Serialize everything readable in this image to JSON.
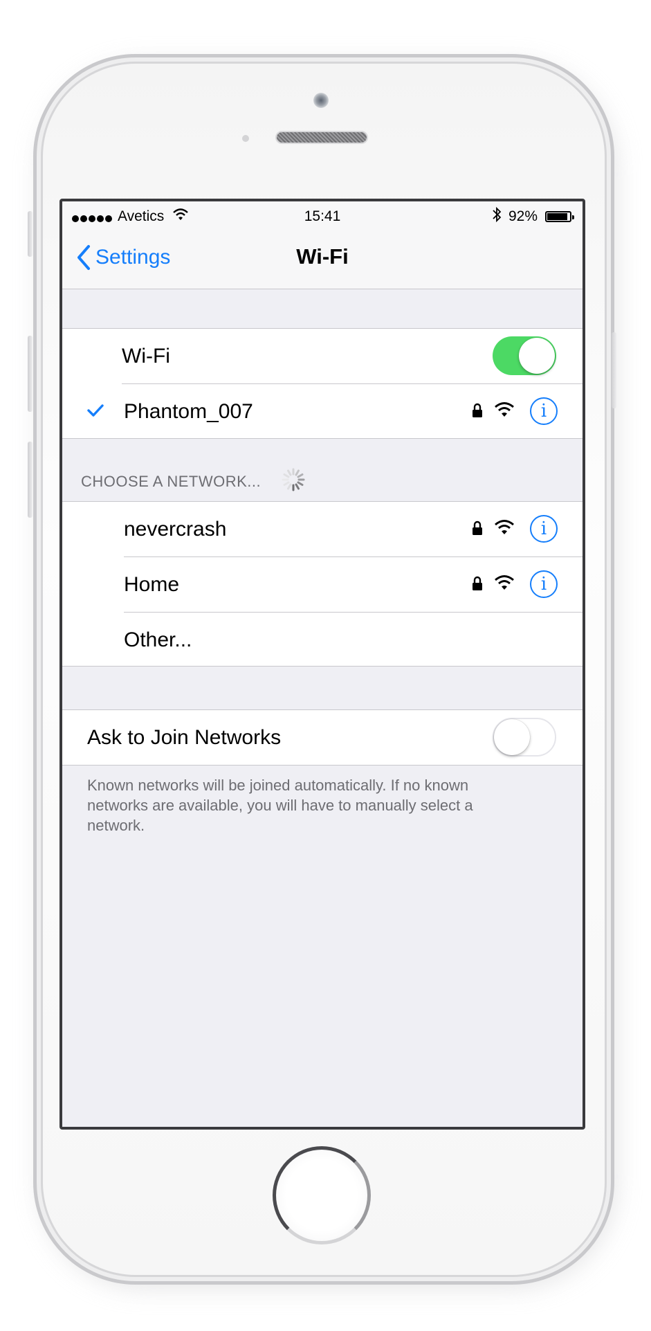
{
  "status_bar": {
    "carrier": "Avetics",
    "time": "15:41",
    "battery_percent": "92%",
    "battery_level": 0.92
  },
  "nav": {
    "back_label": "Settings",
    "title": "Wi-Fi"
  },
  "wifi_toggle": {
    "label": "Wi-Fi",
    "on": true
  },
  "connected_network": {
    "name": "Phantom_007",
    "secured": true
  },
  "choose_section": {
    "header": "CHOOSE A NETWORK...",
    "networks": [
      {
        "name": "nevercrash",
        "secured": true
      },
      {
        "name": "Home",
        "secured": true
      }
    ],
    "other_label": "Other..."
  },
  "ask_to_join": {
    "label": "Ask to Join Networks",
    "on": false,
    "footer": "Known networks will be joined automatically. If no known networks are available, you will have to manually select a network."
  },
  "colors": {
    "accent": "#157efb",
    "toggle_on": "#4cd964",
    "background": "#efeff4",
    "secondary_text": "#6d6d72"
  }
}
